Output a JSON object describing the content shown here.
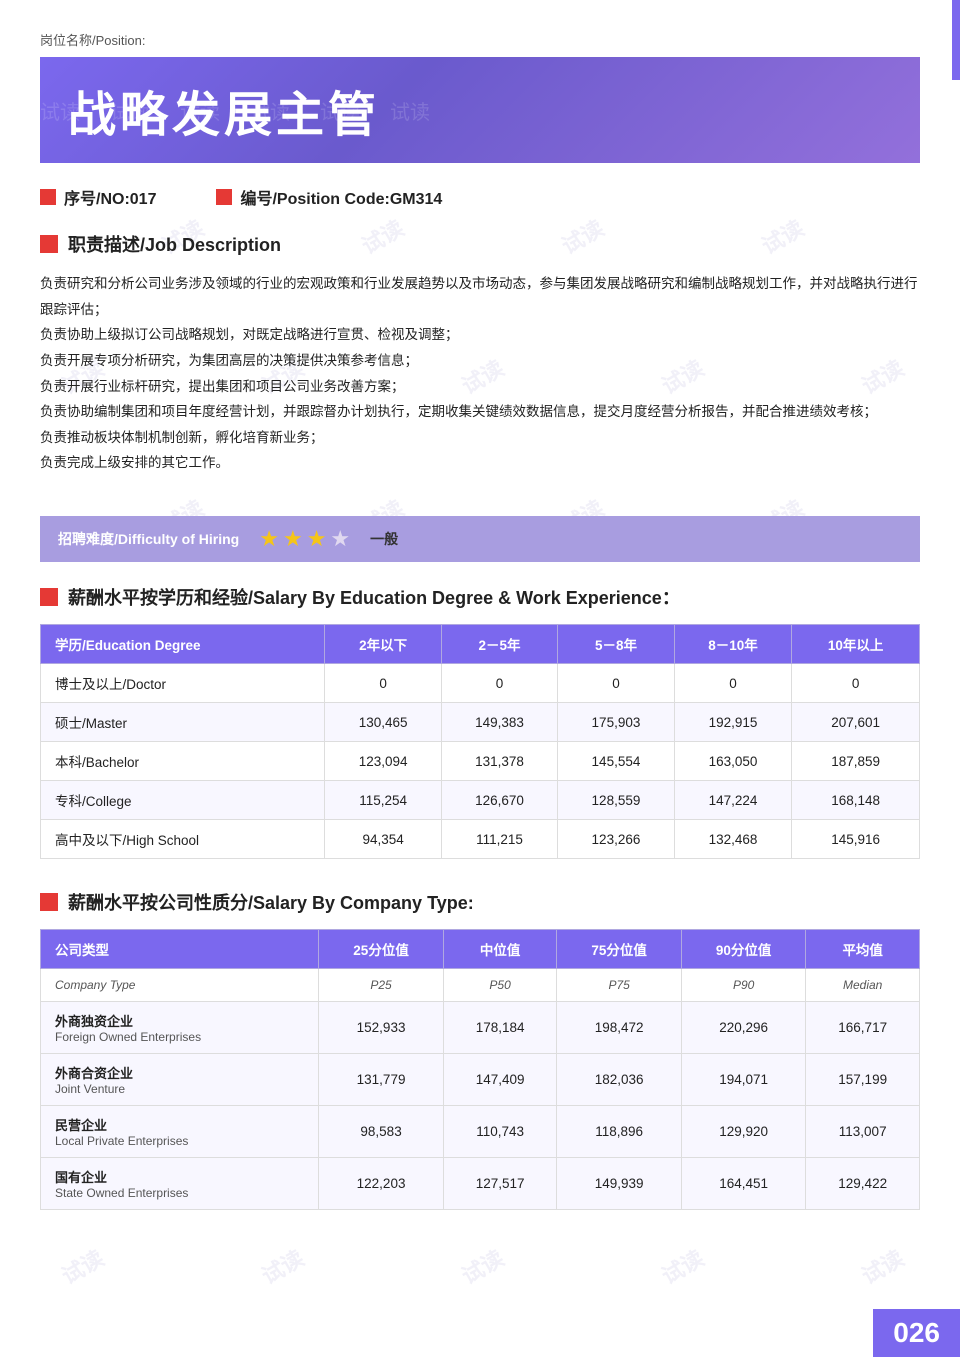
{
  "page": {
    "position_label": "岗位名称/Position:",
    "title": "战略发展主管",
    "no_label": "序号/NO:017",
    "code_label": "编号/Position Code:GM314",
    "job_desc_title": "职责描述/Job Description",
    "job_desc_lines": [
      "负责研究和分析公司业务涉及领域的行业的宏观政策和行业发展趋势以及市场动态，参与集团发展战略研究和编制战略规划工作，并对战略执行进行跟踪评估；",
      "负责协助上级拟订公司战略规划，对既定战略进行宣贯、检视及调整；",
      "负责开展专项分析研究，为集团高层的决策提供决策参考信息；",
      "负责开展行业标杆研究，提出集团和项目公司业务改善方案；",
      "负责协助编制集团和项目年度经营计划，并跟踪督办计划执行，定期收集关键绩效数据信息，提交月度经营分析报告，并配合推进绩效考核；",
      "负责推动板块体制机制创新，孵化培育新业务；",
      "负责完成上级安排的其它工作。"
    ],
    "difficulty_label": "招聘难度/Difficulty of Hiring",
    "stars_filled": 3,
    "stars_empty": 1,
    "difficulty_text": "一般",
    "salary_edu_title": "薪酬水平按学历和经验/Salary By Education Degree & Work Experience：",
    "edu_table": {
      "headers": [
        "学历/Education Degree",
        "2年以下",
        "2－5年",
        "5－8年",
        "8－10年",
        "10年以上"
      ],
      "rows": [
        [
          "博士及以上/Doctor",
          "0",
          "0",
          "0",
          "0",
          "0"
        ],
        [
          "硕士/Master",
          "130,465",
          "149,383",
          "175,903",
          "192,915",
          "207,601"
        ],
        [
          "本科/Bachelor",
          "123,094",
          "131,378",
          "145,554",
          "163,050",
          "187,859"
        ],
        [
          "专科/College",
          "115,254",
          "126,670",
          "128,559",
          "147,224",
          "168,148"
        ],
        [
          "高中及以下/High School",
          "94,354",
          "111,215",
          "123,266",
          "132,468",
          "145,916"
        ]
      ]
    },
    "salary_company_title": "薪酬水平按公司性质分/Salary By Company Type:",
    "company_table": {
      "headers": [
        "公司类型",
        "25分位值",
        "中位值",
        "75分位值",
        "90分位值",
        "平均值"
      ],
      "subheaders": [
        "Company Type",
        "P25",
        "P50",
        "P75",
        "P90",
        "Median"
      ],
      "rows": [
        {
          "cn": "外商独资企业",
          "en": "Foreign Owned Enterprises",
          "values": [
            "152,933",
            "178,184",
            "198,472",
            "220,296",
            "166,717"
          ]
        },
        {
          "cn": "外商合资企业",
          "en": "Joint Venture",
          "values": [
            "131,779",
            "147,409",
            "182,036",
            "194,071",
            "157,199"
          ]
        },
        {
          "cn": "民营企业",
          "en": "Local Private Enterprises",
          "values": [
            "98,583",
            "110,743",
            "118,896",
            "129,920",
            "113,007"
          ]
        },
        {
          "cn": "国有企业",
          "en": "State Owned Enterprises",
          "values": [
            "122,203",
            "127,517",
            "149,939",
            "164,451",
            "129,422"
          ]
        }
      ]
    },
    "page_number": "026"
  },
  "watermarks": [
    "试读",
    "试读",
    "试读",
    "试读",
    "试读",
    "试读",
    "试读",
    "试读",
    "试读",
    "试读",
    "试读",
    "试读",
    "试读",
    "试读",
    "试读",
    "试读",
    "试读",
    "试读",
    "试读",
    "试读",
    "试读",
    "试读",
    "试读",
    "试读"
  ]
}
